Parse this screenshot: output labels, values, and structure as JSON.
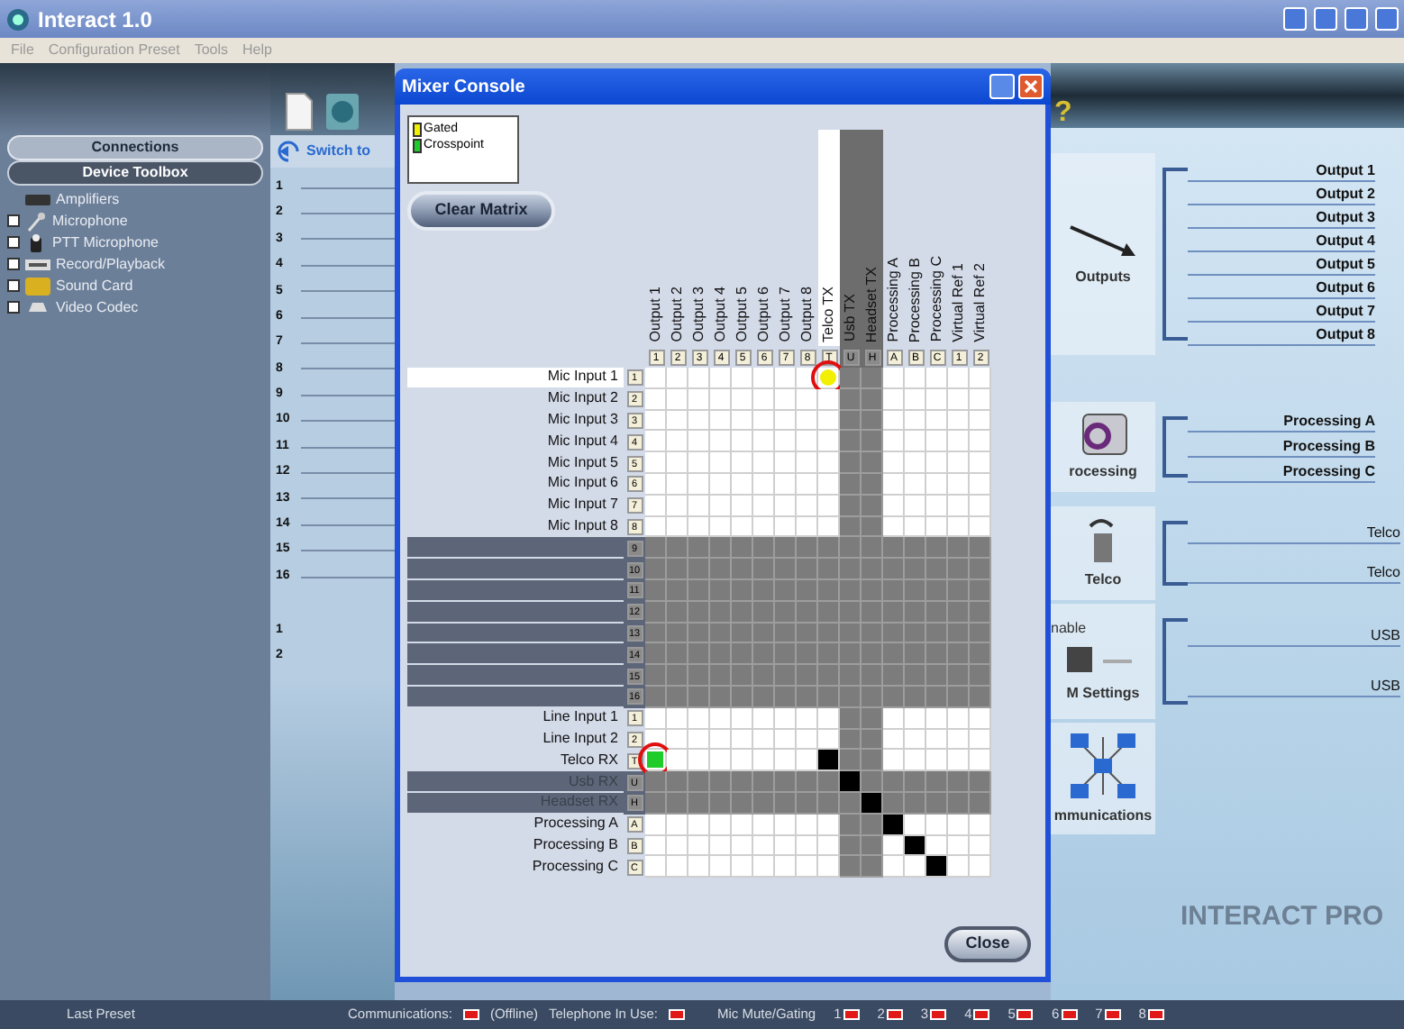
{
  "window": {
    "title": "Interact 1.0"
  },
  "menu": [
    {
      "label": "File"
    },
    {
      "label": "Configuration Preset"
    },
    {
      "label": "Tools"
    },
    {
      "label": "Help"
    }
  ],
  "toolbar": {
    "help_label": "?"
  },
  "sidebar": {
    "tabs": [
      {
        "label": "Connections",
        "selected": false
      },
      {
        "label": "Device Toolbox",
        "selected": true
      }
    ],
    "items": [
      {
        "label": "Amplifiers",
        "kind": "amplifier",
        "expandable": false
      },
      {
        "label": "Microphone",
        "kind": "microphone",
        "expandable": true
      },
      {
        "label": "PTT Microphone",
        "kind": "ptt",
        "expandable": true
      },
      {
        "label": "Record/Playback",
        "kind": "recorder",
        "expandable": true
      },
      {
        "label": "Sound Card",
        "kind": "soundcard",
        "expandable": true
      },
      {
        "label": "Video Codec",
        "kind": "codec",
        "expandable": true
      }
    ]
  },
  "channels": {
    "switch_label": "Switch to",
    "numbers": [
      "1",
      "2",
      "3",
      "4",
      "5",
      "6",
      "7",
      "8",
      "9",
      "10",
      "11",
      "12",
      "13",
      "14",
      "15",
      "16"
    ],
    "numbers_2": [
      "1",
      "2"
    ]
  },
  "overview": {
    "groups": [
      {
        "kind": "outputs",
        "caption": "Outputs",
        "labels": [
          "Output 1",
          "Output 2",
          "Output 3",
          "Output 4",
          "Output 5",
          "Output 6",
          "Output 7",
          "Output 8"
        ]
      },
      {
        "kind": "processing",
        "caption": "rocessing",
        "labels": [
          "Processing A",
          "Processing B",
          "Processing C"
        ]
      },
      {
        "kind": "telco",
        "caption": "Telco",
        "labels": [
          "Telco",
          "Telco"
        ]
      },
      {
        "kind": "usb",
        "top_caption": "nable",
        "caption": "M Settings",
        "labels": [
          "USB",
          "USB"
        ]
      },
      {
        "kind": "communications",
        "caption": "mmunications"
      }
    ],
    "banner": "INTERACT PRO"
  },
  "mixer": {
    "title": "Mixer Console",
    "legend": [
      {
        "kind": "gated",
        "label": "Gated"
      },
      {
        "kind": "crosspoint",
        "label": "Crosspoint"
      }
    ],
    "clear_button": "Clear Matrix",
    "close_button": "Close",
    "columns": [
      {
        "label": "Output 1",
        "index": "1",
        "selected": false,
        "disabled": false
      },
      {
        "label": "Output 2",
        "index": "2",
        "selected": false,
        "disabled": false
      },
      {
        "label": "Output 3",
        "index": "3",
        "selected": false,
        "disabled": false
      },
      {
        "label": "Output 4",
        "index": "4",
        "selected": false,
        "disabled": false
      },
      {
        "label": "Output 5",
        "index": "5",
        "selected": false,
        "disabled": false
      },
      {
        "label": "Output 6",
        "index": "6",
        "selected": false,
        "disabled": false
      },
      {
        "label": "Output 7",
        "index": "7",
        "selected": false,
        "disabled": false
      },
      {
        "label": "Output 8",
        "index": "8",
        "selected": false,
        "disabled": false
      },
      {
        "label": "Telco TX",
        "index": "T",
        "selected": true,
        "disabled": false
      },
      {
        "label": "Usb TX",
        "index": "U",
        "selected": false,
        "disabled": true
      },
      {
        "label": "Headset TX",
        "index": "H",
        "selected": false,
        "disabled": true
      },
      {
        "label": "Processing A",
        "index": "A",
        "selected": false,
        "disabled": false
      },
      {
        "label": "Processing B",
        "index": "B",
        "selected": false,
        "disabled": false
      },
      {
        "label": "Processing C",
        "index": "C",
        "selected": false,
        "disabled": false
      },
      {
        "label": "Virtual Ref 1",
        "index": "1",
        "selected": false,
        "disabled": false
      },
      {
        "label": "Virtual Ref 2",
        "index": "2",
        "selected": false,
        "disabled": false
      }
    ],
    "rows": [
      {
        "label": "Mic Input 1",
        "index": "1",
        "selected": true,
        "disabled": false,
        "cells": [
          {
            "kind": "off",
            "circled": false
          },
          {
            "kind": "off",
            "circled": false
          },
          {
            "kind": "off",
            "circled": false
          },
          {
            "kind": "off",
            "circled": false
          },
          {
            "kind": "off",
            "circled": false
          },
          {
            "kind": "off",
            "circled": false
          },
          {
            "kind": "off",
            "circled": false
          },
          {
            "kind": "off",
            "circled": false
          },
          {
            "kind": "gated",
            "circled": true
          },
          {
            "kind": "off",
            "circled": false
          },
          {
            "kind": "off",
            "circled": false
          },
          {
            "kind": "off",
            "circled": false
          },
          {
            "kind": "off",
            "circled": false
          },
          {
            "kind": "off",
            "circled": false
          },
          {
            "kind": "off",
            "circled": false
          },
          {
            "kind": "off",
            "circled": false
          }
        ]
      },
      {
        "label": "Mic Input 2",
        "index": "2",
        "selected": false,
        "disabled": false,
        "cells": [
          {
            "kind": "off",
            "circled": false
          },
          {
            "kind": "off",
            "circled": false
          },
          {
            "kind": "off",
            "circled": false
          },
          {
            "kind": "off",
            "circled": false
          },
          {
            "kind": "off",
            "circled": false
          },
          {
            "kind": "off",
            "circled": false
          },
          {
            "kind": "off",
            "circled": false
          },
          {
            "kind": "off",
            "circled": false
          },
          {
            "kind": "off",
            "circled": false
          },
          {
            "kind": "off",
            "circled": false
          },
          {
            "kind": "off",
            "circled": false
          },
          {
            "kind": "off",
            "circled": false
          },
          {
            "kind": "off",
            "circled": false
          },
          {
            "kind": "off",
            "circled": false
          },
          {
            "kind": "off",
            "circled": false
          },
          {
            "kind": "off",
            "circled": false
          }
        ]
      },
      {
        "label": "Mic Input 3",
        "index": "3",
        "selected": false,
        "disabled": false,
        "cells": [
          {
            "kind": "off",
            "circled": false
          },
          {
            "kind": "off",
            "circled": false
          },
          {
            "kind": "off",
            "circled": false
          },
          {
            "kind": "off",
            "circled": false
          },
          {
            "kind": "off",
            "circled": false
          },
          {
            "kind": "off",
            "circled": false
          },
          {
            "kind": "off",
            "circled": false
          },
          {
            "kind": "off",
            "circled": false
          },
          {
            "kind": "off",
            "circled": false
          },
          {
            "kind": "off",
            "circled": false
          },
          {
            "kind": "off",
            "circled": false
          },
          {
            "kind": "off",
            "circled": false
          },
          {
            "kind": "off",
            "circled": false
          },
          {
            "kind": "off",
            "circled": false
          },
          {
            "kind": "off",
            "circled": false
          },
          {
            "kind": "off",
            "circled": false
          }
        ]
      },
      {
        "label": "Mic Input 4",
        "index": "4",
        "selected": false,
        "disabled": false,
        "cells": [
          {
            "kind": "off",
            "circled": false
          },
          {
            "kind": "off",
            "circled": false
          },
          {
            "kind": "off",
            "circled": false
          },
          {
            "kind": "off",
            "circled": false
          },
          {
            "kind": "off",
            "circled": false
          },
          {
            "kind": "off",
            "circled": false
          },
          {
            "kind": "off",
            "circled": false
          },
          {
            "kind": "off",
            "circled": false
          },
          {
            "kind": "off",
            "circled": false
          },
          {
            "kind": "off",
            "circled": false
          },
          {
            "kind": "off",
            "circled": false
          },
          {
            "kind": "off",
            "circled": false
          },
          {
            "kind": "off",
            "circled": false
          },
          {
            "kind": "off",
            "circled": false
          },
          {
            "kind": "off",
            "circled": false
          },
          {
            "kind": "off",
            "circled": false
          }
        ]
      },
      {
        "label": "Mic Input 5",
        "index": "5",
        "selected": false,
        "disabled": false,
        "cells": [
          {
            "kind": "off",
            "circled": false
          },
          {
            "kind": "off",
            "circled": false
          },
          {
            "kind": "off",
            "circled": false
          },
          {
            "kind": "off",
            "circled": false
          },
          {
            "kind": "off",
            "circled": false
          },
          {
            "kind": "off",
            "circled": false
          },
          {
            "kind": "off",
            "circled": false
          },
          {
            "kind": "off",
            "circled": false
          },
          {
            "kind": "off",
            "circled": false
          },
          {
            "kind": "off",
            "circled": false
          },
          {
            "kind": "off",
            "circled": false
          },
          {
            "kind": "off",
            "circled": false
          },
          {
            "kind": "off",
            "circled": false
          },
          {
            "kind": "off",
            "circled": false
          },
          {
            "kind": "off",
            "circled": false
          },
          {
            "kind": "off",
            "circled": false
          }
        ]
      },
      {
        "label": "Mic Input 6",
        "index": "6",
        "selected": false,
        "disabled": false,
        "cells": [
          {
            "kind": "off",
            "circled": false
          },
          {
            "kind": "off",
            "circled": false
          },
          {
            "kind": "off",
            "circled": false
          },
          {
            "kind": "off",
            "circled": false
          },
          {
            "kind": "off",
            "circled": false
          },
          {
            "kind": "off",
            "circled": false
          },
          {
            "kind": "off",
            "circled": false
          },
          {
            "kind": "off",
            "circled": false
          },
          {
            "kind": "off",
            "circled": false
          },
          {
            "kind": "off",
            "circled": false
          },
          {
            "kind": "off",
            "circled": false
          },
          {
            "kind": "off",
            "circled": false
          },
          {
            "kind": "off",
            "circled": false
          },
          {
            "kind": "off",
            "circled": false
          },
          {
            "kind": "off",
            "circled": false
          },
          {
            "kind": "off",
            "circled": false
          }
        ]
      },
      {
        "label": "Mic Input 7",
        "index": "7",
        "selected": false,
        "disabled": false,
        "cells": [
          {
            "kind": "off",
            "circled": false
          },
          {
            "kind": "off",
            "circled": false
          },
          {
            "kind": "off",
            "circled": false
          },
          {
            "kind": "off",
            "circled": false
          },
          {
            "kind": "off",
            "circled": false
          },
          {
            "kind": "off",
            "circled": false
          },
          {
            "kind": "off",
            "circled": false
          },
          {
            "kind": "off",
            "circled": false
          },
          {
            "kind": "off",
            "circled": false
          },
          {
            "kind": "off",
            "circled": false
          },
          {
            "kind": "off",
            "circled": false
          },
          {
            "kind": "off",
            "circled": false
          },
          {
            "kind": "off",
            "circled": false
          },
          {
            "kind": "off",
            "circled": false
          },
          {
            "kind": "off",
            "circled": false
          },
          {
            "kind": "off",
            "circled": false
          }
        ]
      },
      {
        "label": "Mic Input 8",
        "index": "8",
        "selected": false,
        "disabled": false,
        "cells": [
          {
            "kind": "off",
            "circled": false
          },
          {
            "kind": "off",
            "circled": false
          },
          {
            "kind": "off",
            "circled": false
          },
          {
            "kind": "off",
            "circled": false
          },
          {
            "kind": "off",
            "circled": false
          },
          {
            "kind": "off",
            "circled": false
          },
          {
            "kind": "off",
            "circled": false
          },
          {
            "kind": "off",
            "circled": false
          },
          {
            "kind": "off",
            "circled": false
          },
          {
            "kind": "off",
            "circled": false
          },
          {
            "kind": "off",
            "circled": false
          },
          {
            "kind": "off",
            "circled": false
          },
          {
            "kind": "off",
            "circled": false
          },
          {
            "kind": "off",
            "circled": false
          },
          {
            "kind": "off",
            "circled": false
          },
          {
            "kind": "off",
            "circled": false
          }
        ]
      },
      {
        "index": "9",
        "selected": false,
        "disabled": true,
        "cells": [
          {
            "kind": "off",
            "circled": false
          },
          {
            "kind": "off",
            "circled": false
          },
          {
            "kind": "off",
            "circled": false
          },
          {
            "kind": "off",
            "circled": false
          },
          {
            "kind": "off",
            "circled": false
          },
          {
            "kind": "off",
            "circled": false
          },
          {
            "kind": "off",
            "circled": false
          },
          {
            "kind": "off",
            "circled": false
          },
          {
            "kind": "off",
            "circled": false
          },
          {
            "kind": "off",
            "circled": false
          },
          {
            "kind": "off",
            "circled": false
          },
          {
            "kind": "off",
            "circled": false
          },
          {
            "kind": "off",
            "circled": false
          },
          {
            "kind": "off",
            "circled": false
          },
          {
            "kind": "off",
            "circled": false
          },
          {
            "kind": "off",
            "circled": false
          }
        ]
      },
      {
        "index": "10",
        "selected": false,
        "disabled": true,
        "cells": [
          {
            "kind": "off",
            "circled": false
          },
          {
            "kind": "off",
            "circled": false
          },
          {
            "kind": "off",
            "circled": false
          },
          {
            "kind": "off",
            "circled": false
          },
          {
            "kind": "off",
            "circled": false
          },
          {
            "kind": "off",
            "circled": false
          },
          {
            "kind": "off",
            "circled": false
          },
          {
            "kind": "off",
            "circled": false
          },
          {
            "kind": "off",
            "circled": false
          },
          {
            "kind": "off",
            "circled": false
          },
          {
            "kind": "off",
            "circled": false
          },
          {
            "kind": "off",
            "circled": false
          },
          {
            "kind": "off",
            "circled": false
          },
          {
            "kind": "off",
            "circled": false
          },
          {
            "kind": "off",
            "circled": false
          },
          {
            "kind": "off",
            "circled": false
          }
        ]
      },
      {
        "index": "11",
        "selected": false,
        "disabled": true,
        "cells": [
          {
            "kind": "off",
            "circled": false
          },
          {
            "kind": "off",
            "circled": false
          },
          {
            "kind": "off",
            "circled": false
          },
          {
            "kind": "off",
            "circled": false
          },
          {
            "kind": "off",
            "circled": false
          },
          {
            "kind": "off",
            "circled": false
          },
          {
            "kind": "off",
            "circled": false
          },
          {
            "kind": "off",
            "circled": false
          },
          {
            "kind": "off",
            "circled": false
          },
          {
            "kind": "off",
            "circled": false
          },
          {
            "kind": "off",
            "circled": false
          },
          {
            "kind": "off",
            "circled": false
          },
          {
            "kind": "off",
            "circled": false
          },
          {
            "kind": "off",
            "circled": false
          },
          {
            "kind": "off",
            "circled": false
          },
          {
            "kind": "off",
            "circled": false
          }
        ]
      },
      {
        "index": "12",
        "selected": false,
        "disabled": true,
        "cells": [
          {
            "kind": "off",
            "circled": false
          },
          {
            "kind": "off",
            "circled": false
          },
          {
            "kind": "off",
            "circled": false
          },
          {
            "kind": "off",
            "circled": false
          },
          {
            "kind": "off",
            "circled": false
          },
          {
            "kind": "off",
            "circled": false
          },
          {
            "kind": "off",
            "circled": false
          },
          {
            "kind": "off",
            "circled": false
          },
          {
            "kind": "off",
            "circled": false
          },
          {
            "kind": "off",
            "circled": false
          },
          {
            "kind": "off",
            "circled": false
          },
          {
            "kind": "off",
            "circled": false
          },
          {
            "kind": "off",
            "circled": false
          },
          {
            "kind": "off",
            "circled": false
          },
          {
            "kind": "off",
            "circled": false
          },
          {
            "kind": "off",
            "circled": false
          }
        ]
      },
      {
        "index": "13",
        "selected": false,
        "disabled": true,
        "cells": [
          {
            "kind": "off",
            "circled": false
          },
          {
            "kind": "off",
            "circled": false
          },
          {
            "kind": "off",
            "circled": false
          },
          {
            "kind": "off",
            "circled": false
          },
          {
            "kind": "off",
            "circled": false
          },
          {
            "kind": "off",
            "circled": false
          },
          {
            "kind": "off",
            "circled": false
          },
          {
            "kind": "off",
            "circled": false
          },
          {
            "kind": "off",
            "circled": false
          },
          {
            "kind": "off",
            "circled": false
          },
          {
            "kind": "off",
            "circled": false
          },
          {
            "kind": "off",
            "circled": false
          },
          {
            "kind": "off",
            "circled": false
          },
          {
            "kind": "off",
            "circled": false
          },
          {
            "kind": "off",
            "circled": false
          },
          {
            "kind": "off",
            "circled": false
          }
        ]
      },
      {
        "index": "14",
        "selected": false,
        "disabled": true,
        "cells": [
          {
            "kind": "off",
            "circled": false
          },
          {
            "kind": "off",
            "circled": false
          },
          {
            "kind": "off",
            "circled": false
          },
          {
            "kind": "off",
            "circled": false
          },
          {
            "kind": "off",
            "circled": false
          },
          {
            "kind": "off",
            "circled": false
          },
          {
            "kind": "off",
            "circled": false
          },
          {
            "kind": "off",
            "circled": false
          },
          {
            "kind": "off",
            "circled": false
          },
          {
            "kind": "off",
            "circled": false
          },
          {
            "kind": "off",
            "circled": false
          },
          {
            "kind": "off",
            "circled": false
          },
          {
            "kind": "off",
            "circled": false
          },
          {
            "kind": "off",
            "circled": false
          },
          {
            "kind": "off",
            "circled": false
          },
          {
            "kind": "off",
            "circled": false
          }
        ]
      },
      {
        "index": "15",
        "selected": false,
        "disabled": true,
        "cells": [
          {
            "kind": "off",
            "circled": false
          },
          {
            "kind": "off",
            "circled": false
          },
          {
            "kind": "off",
            "circled": false
          },
          {
            "kind": "off",
            "circled": false
          },
          {
            "kind": "off",
            "circled": false
          },
          {
            "kind": "off",
            "circled": false
          },
          {
            "kind": "off",
            "circled": false
          },
          {
            "kind": "off",
            "circled": false
          },
          {
            "kind": "off",
            "circled": false
          },
          {
            "kind": "off",
            "circled": false
          },
          {
            "kind": "off",
            "circled": false
          },
          {
            "kind": "off",
            "circled": false
          },
          {
            "kind": "off",
            "circled": false
          },
          {
            "kind": "off",
            "circled": false
          },
          {
            "kind": "off",
            "circled": false
          },
          {
            "kind": "off",
            "circled": false
          }
        ]
      },
      {
        "index": "16",
        "selected": false,
        "disabled": true,
        "cells": [
          {
            "kind": "off",
            "circled": false
          },
          {
            "kind": "off",
            "circled": false
          },
          {
            "kind": "off",
            "circled": false
          },
          {
            "kind": "off",
            "circled": false
          },
          {
            "kind": "off",
            "circled": false
          },
          {
            "kind": "off",
            "circled": false
          },
          {
            "kind": "off",
            "circled": false
          },
          {
            "kind": "off",
            "circled": false
          },
          {
            "kind": "off",
            "circled": false
          },
          {
            "kind": "off",
            "circled": false
          },
          {
            "kind": "off",
            "circled": false
          },
          {
            "kind": "off",
            "circled": false
          },
          {
            "kind": "off",
            "circled": false
          },
          {
            "kind": "off",
            "circled": false
          },
          {
            "kind": "off",
            "circled": false
          },
          {
            "kind": "off",
            "circled": false
          }
        ]
      },
      {
        "label": "Line Input 1",
        "index": "1",
        "selected": false,
        "disabled": false,
        "cells": [
          {
            "kind": "off",
            "circled": false
          },
          {
            "kind": "off",
            "circled": false
          },
          {
            "kind": "off",
            "circled": false
          },
          {
            "kind": "off",
            "circled": false
          },
          {
            "kind": "off",
            "circled": false
          },
          {
            "kind": "off",
            "circled": false
          },
          {
            "kind": "off",
            "circled": false
          },
          {
            "kind": "off",
            "circled": false
          },
          {
            "kind": "off",
            "circled": false
          },
          {
            "kind": "off",
            "circled": false
          },
          {
            "kind": "off",
            "circled": false
          },
          {
            "kind": "off",
            "circled": false
          },
          {
            "kind": "off",
            "circled": false
          },
          {
            "kind": "off",
            "circled": false
          },
          {
            "kind": "off",
            "circled": false
          },
          {
            "kind": "off",
            "circled": false
          }
        ]
      },
      {
        "label": "Line Input 2",
        "index": "2",
        "selected": false,
        "disabled": false,
        "cells": [
          {
            "kind": "off",
            "circled": false
          },
          {
            "kind": "off",
            "circled": false
          },
          {
            "kind": "off",
            "circled": false
          },
          {
            "kind": "off",
            "circled": false
          },
          {
            "kind": "off",
            "circled": false
          },
          {
            "kind": "off",
            "circled": false
          },
          {
            "kind": "off",
            "circled": false
          },
          {
            "kind": "off",
            "circled": false
          },
          {
            "kind": "off",
            "circled": false
          },
          {
            "kind": "off",
            "circled": false
          },
          {
            "kind": "off",
            "circled": false
          },
          {
            "kind": "off",
            "circled": false
          },
          {
            "kind": "off",
            "circled": false
          },
          {
            "kind": "off",
            "circled": false
          },
          {
            "kind": "off",
            "circled": false
          },
          {
            "kind": "off",
            "circled": false
          }
        ]
      },
      {
        "label": "Telco RX",
        "index": "T",
        "selected": false,
        "disabled": false,
        "cells": [
          {
            "kind": "crosspoint",
            "circled": true
          },
          {
            "kind": "off",
            "circled": false
          },
          {
            "kind": "off",
            "circled": false
          },
          {
            "kind": "off",
            "circled": false
          },
          {
            "kind": "off",
            "circled": false
          },
          {
            "kind": "off",
            "circled": false
          },
          {
            "kind": "off",
            "circled": false
          },
          {
            "kind": "off",
            "circled": false
          },
          {
            "kind": "blocked",
            "circled": false
          },
          {
            "kind": "off",
            "circled": false
          },
          {
            "kind": "off",
            "circled": false
          },
          {
            "kind": "off",
            "circled": false
          },
          {
            "kind": "off",
            "circled": false
          },
          {
            "kind": "off",
            "circled": false
          },
          {
            "kind": "off",
            "circled": false
          },
          {
            "kind": "off",
            "circled": false
          }
        ]
      },
      {
        "label": "Usb RX",
        "index": "U",
        "selected": false,
        "disabled": true,
        "cells": [
          {
            "kind": "off",
            "circled": false
          },
          {
            "kind": "off",
            "circled": false
          },
          {
            "kind": "off",
            "circled": false
          },
          {
            "kind": "off",
            "circled": false
          },
          {
            "kind": "off",
            "circled": false
          },
          {
            "kind": "off",
            "circled": false
          },
          {
            "kind": "off",
            "circled": false
          },
          {
            "kind": "off",
            "circled": false
          },
          {
            "kind": "off",
            "circled": false
          },
          {
            "kind": "blocked",
            "circled": false
          },
          {
            "kind": "off",
            "circled": false
          },
          {
            "kind": "off",
            "circled": false
          },
          {
            "kind": "off",
            "circled": false
          },
          {
            "kind": "off",
            "circled": false
          },
          {
            "kind": "off",
            "circled": false
          },
          {
            "kind": "off",
            "circled": false
          }
        ]
      },
      {
        "label": "Headset RX",
        "index": "H",
        "selected": false,
        "disabled": true,
        "cells": [
          {
            "kind": "off",
            "circled": false
          },
          {
            "kind": "off",
            "circled": false
          },
          {
            "kind": "off",
            "circled": false
          },
          {
            "kind": "off",
            "circled": false
          },
          {
            "kind": "off",
            "circled": false
          },
          {
            "kind": "off",
            "circled": false
          },
          {
            "kind": "off",
            "circled": false
          },
          {
            "kind": "off",
            "circled": false
          },
          {
            "kind": "off",
            "circled": false
          },
          {
            "kind": "off",
            "circled": false
          },
          {
            "kind": "blocked",
            "circled": false
          },
          {
            "kind": "off",
            "circled": false
          },
          {
            "kind": "off",
            "circled": false
          },
          {
            "kind": "off",
            "circled": false
          },
          {
            "kind": "off",
            "circled": false
          },
          {
            "kind": "off",
            "circled": false
          }
        ]
      },
      {
        "label": "Processing A",
        "index": "A",
        "selected": false,
        "disabled": false,
        "cells": [
          {
            "kind": "off",
            "circled": false
          },
          {
            "kind": "off",
            "circled": false
          },
          {
            "kind": "off",
            "circled": false
          },
          {
            "kind": "off",
            "circled": false
          },
          {
            "kind": "off",
            "circled": false
          },
          {
            "kind": "off",
            "circled": false
          },
          {
            "kind": "off",
            "circled": false
          },
          {
            "kind": "off",
            "circled": false
          },
          {
            "kind": "off",
            "circled": false
          },
          {
            "kind": "off",
            "circled": false
          },
          {
            "kind": "off",
            "circled": false
          },
          {
            "kind": "blocked",
            "circled": false
          },
          {
            "kind": "off",
            "circled": false
          },
          {
            "kind": "off",
            "circled": false
          },
          {
            "kind": "off",
            "circled": false
          },
          {
            "kind": "off",
            "circled": false
          }
        ]
      },
      {
        "label": "Processing B",
        "index": "B",
        "selected": false,
        "disabled": false,
        "cells": [
          {
            "kind": "off",
            "circled": false
          },
          {
            "kind": "off",
            "circled": false
          },
          {
            "kind": "off",
            "circled": false
          },
          {
            "kind": "off",
            "circled": false
          },
          {
            "kind": "off",
            "circled": false
          },
          {
            "kind": "off",
            "circled": false
          },
          {
            "kind": "off",
            "circled": false
          },
          {
            "kind": "off",
            "circled": false
          },
          {
            "kind": "off",
            "circled": false
          },
          {
            "kind": "off",
            "circled": false
          },
          {
            "kind": "off",
            "circled": false
          },
          {
            "kind": "off",
            "circled": false
          },
          {
            "kind": "blocked",
            "circled": false
          },
          {
            "kind": "off",
            "circled": false
          },
          {
            "kind": "off",
            "circled": false
          },
          {
            "kind": "off",
            "circled": false
          }
        ]
      },
      {
        "label": "Processing C",
        "index": "C",
        "selected": false,
        "disabled": false,
        "cells": [
          {
            "kind": "off",
            "circled": false
          },
          {
            "kind": "off",
            "circled": false
          },
          {
            "kind": "off",
            "circled": false
          },
          {
            "kind": "off",
            "circled": false
          },
          {
            "kind": "off",
            "circled": false
          },
          {
            "kind": "off",
            "circled": false
          },
          {
            "kind": "off",
            "circled": false
          },
          {
            "kind": "off",
            "circled": false
          },
          {
            "kind": "off",
            "circled": false
          },
          {
            "kind": "off",
            "circled": false
          },
          {
            "kind": "off",
            "circled": false
          },
          {
            "kind": "off",
            "circled": false
          },
          {
            "kind": "off",
            "circled": false
          },
          {
            "kind": "blocked",
            "circled": false
          },
          {
            "kind": "off",
            "circled": false
          },
          {
            "kind": "off",
            "circled": false
          }
        ]
      }
    ]
  },
  "status_bar": {
    "last_preset": "Last Preset",
    "communications": "Communications:",
    "communications_value": "(Offline)",
    "telephone": "Telephone In Use:",
    "mic": "Mic Mute/Gating",
    "mic_channels": [
      "1",
      "2",
      "3",
      "4",
      "5",
      "6",
      "7",
      "8"
    ]
  }
}
